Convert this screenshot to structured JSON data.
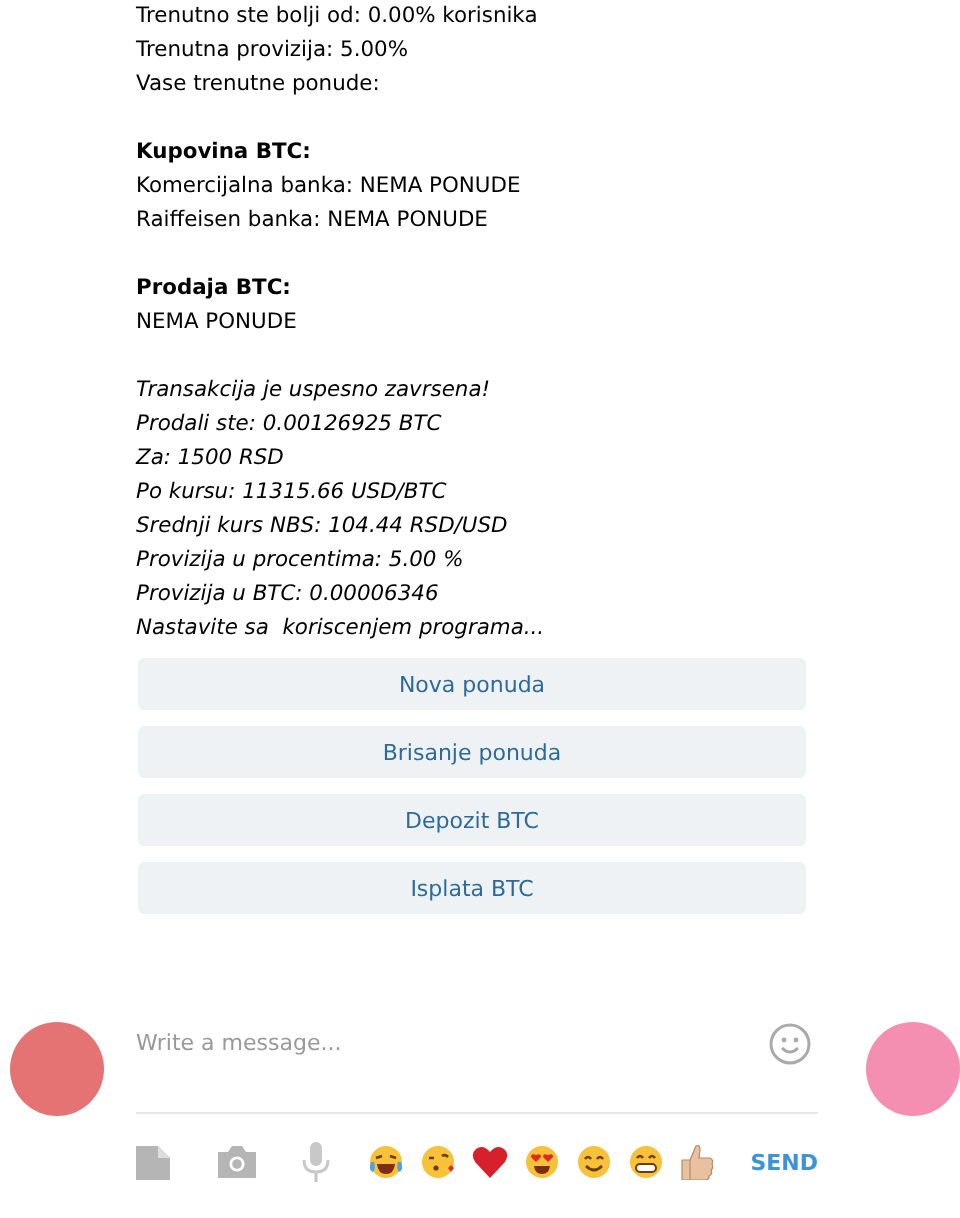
{
  "message_blocks": [
    {
      "italic": false,
      "lines": [
        "Trenutno ste bolji od: 0.00% korisnika",
        "Trenutna provizija: 5.00%",
        "Vase trenutne ponude:"
      ]
    },
    {
      "italic": false,
      "heading": "Kupovina BTC:",
      "lines": [
        "Komercijalna banka: NEMA PONUDE",
        "Raiffeisen banka: NEMA PONUDE"
      ]
    },
    {
      "italic": false,
      "heading": "Prodaja BTC:",
      "lines": [
        "NEMA PONUDE"
      ]
    },
    {
      "italic": true,
      "lines": [
        "Transakcija je uspesno zavrsena!",
        "Prodali ste: 0.00126925 BTC",
        "Za: 1500 RSD",
        "Po kursu: 11315.66 USD/BTC",
        "Srednji kurs NBS: 104.44 RSD/USD",
        "Provizija u procentima: 5.00 %",
        "Provizija u BTC: 0.00006346",
        "Nastavite sa  koriscenjem programa..."
      ]
    }
  ],
  "keyboard_buttons": [
    "Nova ponuda",
    "Brisanje ponuda",
    "Depozit BTC",
    "Isplata BTC"
  ],
  "avatars": [
    {
      "color": "#e57373"
    },
    {
      "color": "#f48fb1"
    }
  ],
  "composer": {
    "placeholder": "Write a message...",
    "send": "SEND"
  }
}
